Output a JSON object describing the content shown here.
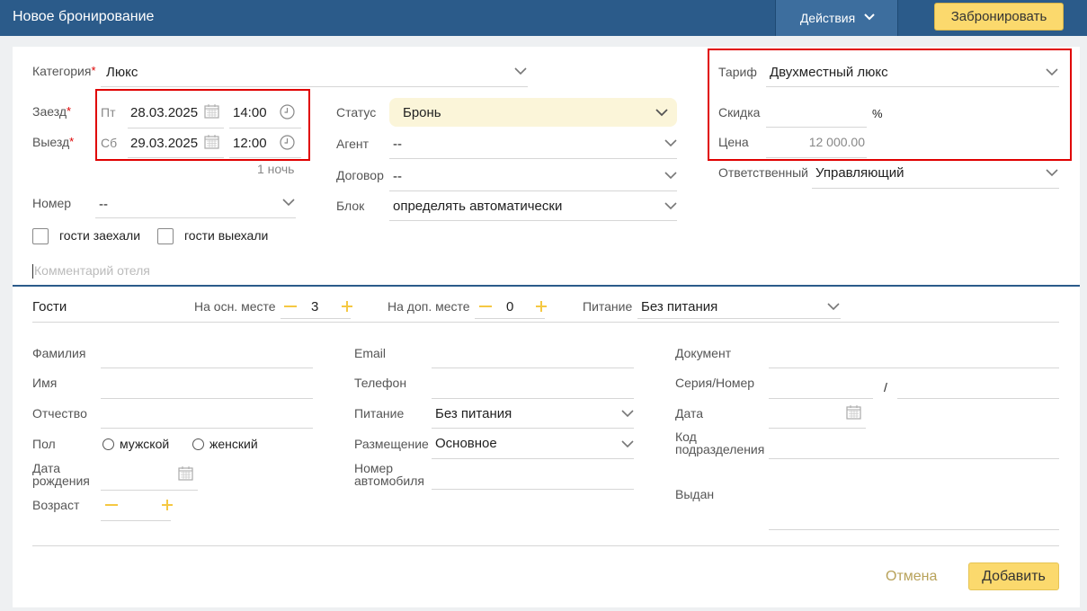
{
  "header": {
    "title": "Новое бронирование",
    "actions_label": "Действия",
    "book_label": "Забронировать"
  },
  "booking": {
    "category_label": "Категория",
    "category_value": "Люкс",
    "checkin_label": "Заезд",
    "checkin_day": "Пт",
    "checkin_date": "28.03.2025",
    "checkin_time": "14:00",
    "checkout_label": "Выезд",
    "checkout_day": "Сб",
    "checkout_date": "29.03.2025",
    "checkout_time": "12:00",
    "nights": "1 ночь",
    "room_label": "Номер",
    "room_value": "--",
    "guests_in_label": "гости заехали",
    "guests_out_label": "гости выехали",
    "comment_placeholder": "Комментарий отеля",
    "required_mark": "*"
  },
  "middle": {
    "status_label": "Статус",
    "status_value": "Бронь",
    "agent_label": "Агент",
    "agent_value": "--",
    "contract_label": "Договор",
    "contract_value": "--",
    "block_label": "Блок",
    "block_value": "определять автоматически"
  },
  "tariff": {
    "tariff_label": "Тариф",
    "tariff_value": "Двухместный люкс",
    "discount_label": "Скидка",
    "discount_unit": "%",
    "price_label": "Цена",
    "price_value": "12 000.00",
    "responsible_label": "Ответственный",
    "responsible_value": "Управляющий"
  },
  "guests": {
    "title": "Гости",
    "main_place_label": "На осн. месте",
    "main_place_value": "3",
    "extra_place_label": "На доп. месте",
    "extra_place_value": "0",
    "meal_label": "Питание",
    "meal_value": "Без питания"
  },
  "guest_form": {
    "surname_label": "Фамилия",
    "name_label": "Имя",
    "patronymic_label": "Отчество",
    "gender_label": "Пол",
    "gender_male": "мужской",
    "gender_female": "женский",
    "birthdate_label_1": "Дата",
    "birthdate_label_2": "рождения",
    "age_label": "Возраст",
    "email_label": "Email",
    "phone_label": "Телефон",
    "meal_label": "Питание",
    "meal_value": "Без питания",
    "placement_label": "Размещение",
    "placement_value": "Основное",
    "car_label_1": "Номер",
    "car_label_2": "автомобиля",
    "document_label": "Документ",
    "series_label": "Серия/Номер",
    "series_separator": "/",
    "date_label": "Дата",
    "division_label_1": "Код",
    "division_label_2": "подразделения",
    "issued_label": "Выдан"
  },
  "footer": {
    "cancel_label": "Отмена",
    "add_label": "Добавить"
  },
  "colors": {
    "header_bg": "#2b5b8a",
    "accent_yellow": "#fbd96d",
    "highlight_red": "#e00000",
    "status_bg": "#fbf5d9"
  }
}
